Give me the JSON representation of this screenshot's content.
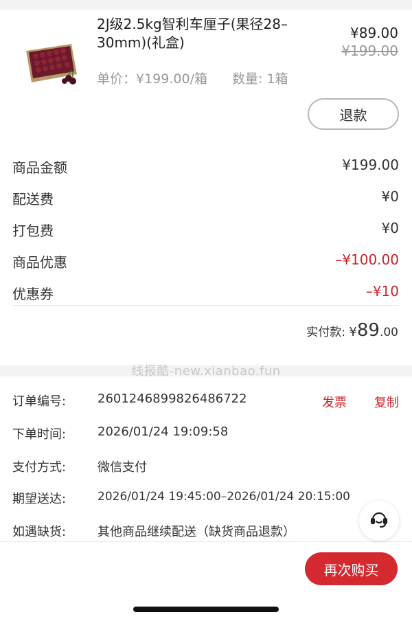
{
  "product": {
    "title": "2J级2.5kg智利车厘子(果径28–30mm)(礼盒)",
    "price_now": "¥89.00",
    "price_original": "¥199.00",
    "unit_price": "单价：¥199.00/箱",
    "quantity": "数量: 1箱",
    "image_icon": "cherry-box-icon"
  },
  "refund_label": "退款",
  "fees": [
    {
      "label": "商品金额",
      "value": "¥199.00"
    },
    {
      "label": "配送费",
      "value": "¥0"
    },
    {
      "label": "打包费",
      "value": "¥0"
    },
    {
      "label": "商品优惠",
      "value": "–¥100.00"
    },
    {
      "label": "优惠券",
      "value": "–¥10"
    }
  ],
  "paid": {
    "label": "实付款: ",
    "currency": "¥",
    "integer": "89",
    "decimal": ".00"
  },
  "watermark": "线报酷-new.xianbao.fun",
  "order_info": [
    {
      "label": "订单编号:",
      "value": "2601246899826486722"
    },
    {
      "label": "下单时间:",
      "value": "2026/01/24 19:09:58"
    },
    {
      "label": "支付方式:",
      "value": "微信支付"
    },
    {
      "label": "期望送达:",
      "value": "2026/01/24 19:45:00–2026/01/24 20:15:00"
    },
    {
      "label": "如遇缺货:",
      "value": "其他商品继续配送（缺货商品退款）"
    }
  ],
  "invoice_label": "发票",
  "copy_label": "复制",
  "buy_again_label": "再次购买",
  "service_icon": "customer-service-icon",
  "colors": {
    "accent_red": "#d42a2f",
    "discount_red": "#c8252c"
  }
}
